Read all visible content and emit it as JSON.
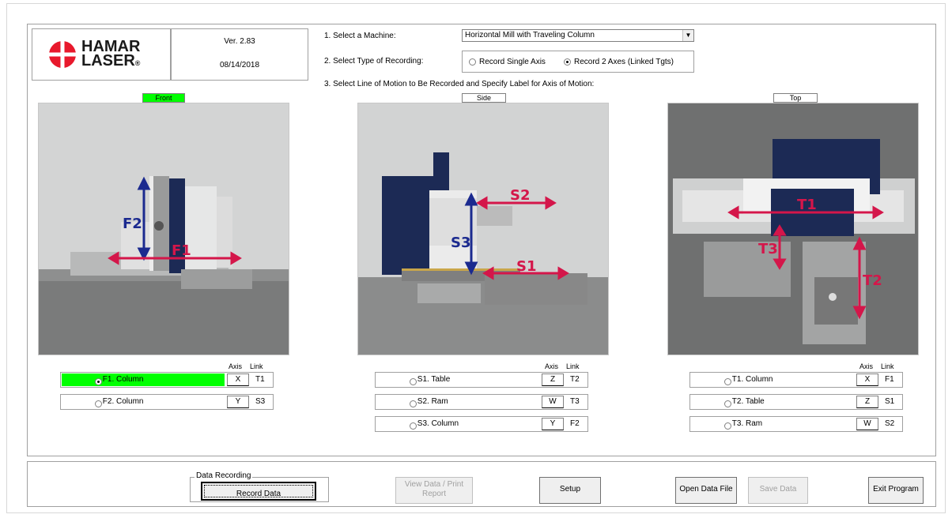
{
  "logo": {
    "line1": "HAMAR",
    "line2": "LASER",
    "reg": "®"
  },
  "version": {
    "ver": "Ver. 2.83",
    "date": "08/14/2018"
  },
  "steps": {
    "select_machine": "1. Select a Machine:",
    "select_recording": "2. Select Type of Recording:",
    "select_motion": "3. Select Line of Motion to Be Recorded and Specify Label for Axis of Motion:"
  },
  "machine_select": {
    "value": "Horizontal Mill with Traveling Column"
  },
  "recording": {
    "single_label": "Record Single Axis",
    "linked_label": "Record 2 Axes (Linked Tgts)",
    "selected": "linked"
  },
  "views": {
    "front": {
      "label": "Front",
      "arrows": [
        "F2",
        "F1"
      ],
      "options": [
        {
          "label": "F1. Column",
          "axis": "X",
          "link": "T1",
          "selected": true
        },
        {
          "label": "F2. Column",
          "axis": "Y",
          "link": "S3",
          "selected": false
        }
      ]
    },
    "side": {
      "label": "Side",
      "arrows": [
        "S2",
        "S3",
        "S1"
      ],
      "options": [
        {
          "label": "S1. Table",
          "axis": "Z",
          "link": "T2",
          "selected": false
        },
        {
          "label": "S2. Ram",
          "axis": "W",
          "link": "T3",
          "selected": false
        },
        {
          "label": "S3. Column",
          "axis": "Y",
          "link": "F2",
          "selected": false
        }
      ]
    },
    "top": {
      "label": "Top",
      "arrows": [
        "T1",
        "T3",
        "T2"
      ],
      "options": [
        {
          "label": "T1. Column",
          "axis": "X",
          "link": "F1",
          "selected": false
        },
        {
          "label": "T2. Table",
          "axis": "Z",
          "link": "S1",
          "selected": false
        },
        {
          "label": "T3. Ram",
          "axis": "W",
          "link": "S2",
          "selected": false
        }
      ]
    }
  },
  "column_headers": {
    "axis": "Axis",
    "link": "Link"
  },
  "buttons": {
    "group_title": "Data Recording",
    "record": "Record Data",
    "view": "View Data / Print Report",
    "setup": "Setup",
    "open": "Open Data File",
    "save": "Save Data",
    "exit": "Exit Program"
  },
  "colors": {
    "arrow_red": "#d4164a",
    "arrow_blue": "#1b2a8f",
    "highlight_green": "#00ff00",
    "logo_red": "#e8192c"
  }
}
